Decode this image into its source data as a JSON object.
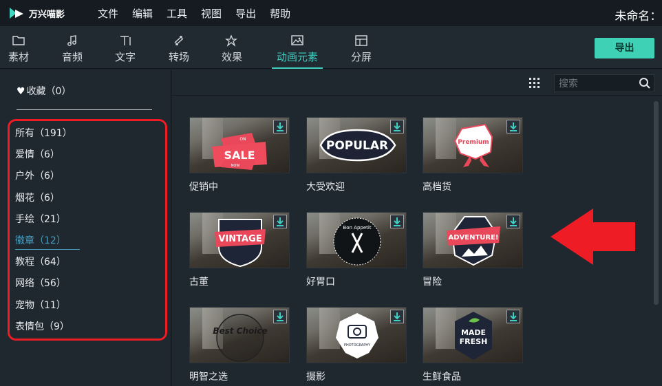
{
  "app": {
    "logo_text": "万兴喵影",
    "title": "未命名：("
  },
  "menu": [
    "文件",
    "编辑",
    "工具",
    "视图",
    "导出",
    "帮助"
  ],
  "toolbar": {
    "tabs": [
      {
        "label": "素材",
        "icon": "folder-icon"
      },
      {
        "label": "音频",
        "icon": "music-note-icon"
      },
      {
        "label": "文字",
        "icon": "text-icon"
      },
      {
        "label": "转场",
        "icon": "transition-icon"
      },
      {
        "label": "效果",
        "icon": "effects-icon"
      },
      {
        "label": "动画元素",
        "icon": "image-icon",
        "active": true
      },
      {
        "label": "分屏",
        "icon": "split-screen-icon"
      }
    ],
    "export_label": "导出",
    "accent": "#3fd1c3"
  },
  "sidebar": {
    "favorites": "收藏（0）",
    "categories": [
      {
        "label": "所有（191）"
      },
      {
        "label": "爱情（6）"
      },
      {
        "label": "户外（6）"
      },
      {
        "label": "烟花（6）"
      },
      {
        "label": "手绘（21）"
      },
      {
        "label": "徽章（12）",
        "active": true
      },
      {
        "label": "教程（64）"
      },
      {
        "label": "网络（56）"
      },
      {
        "label": "宠物（11）"
      },
      {
        "label": "表情包（9）"
      }
    ]
  },
  "search": {
    "placeholder": "搜索"
  },
  "items": [
    {
      "label": "促销中",
      "badge": "SALE",
      "badge_small_top": "ON",
      "badge_small_bottom": "NOW"
    },
    {
      "label": "大受欢迎",
      "badge": "POPULAR"
    },
    {
      "label": "高档货",
      "badge": "Premium"
    },
    {
      "label": "古董",
      "badge": "VINTAGE"
    },
    {
      "label": "好胃口",
      "badge": "Bon Appetit"
    },
    {
      "label": "冒险",
      "badge": "ADVENTURE!"
    },
    {
      "label": "明智之选",
      "badge": "Best Choice"
    },
    {
      "label": "摄影",
      "badge": "PHOTOGRAPHY"
    },
    {
      "label": "生鲜食品",
      "badge": "MADE FRESH"
    }
  ],
  "annotation_color": "#ee1c25"
}
